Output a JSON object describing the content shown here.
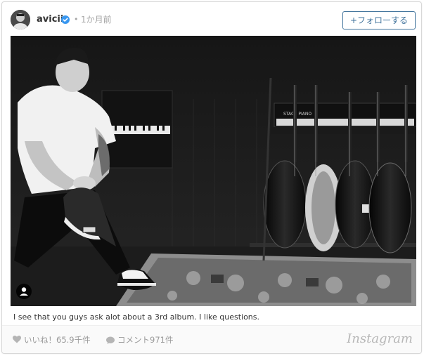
{
  "post": {
    "username": "avicii",
    "dot": "•",
    "time_ago": "1か月前",
    "follow_label": "+フォローする",
    "caption": "I see that you guys ask alot about a 3rd album. I like questions.",
    "likes": "いいね！65.9千件",
    "comments": "コメント971件",
    "brand": "Instagram"
  },
  "photo": {
    "piano_label": "STAGE PIANO",
    "subject": "man seated by piano with guitars",
    "style": "black-and-white"
  },
  "icons": {
    "verified": "verified-badge-icon",
    "heart": "heart-icon",
    "comment": "comment-bubble-icon",
    "user_tag": "user-tag-icon"
  },
  "colors": {
    "accent": "#3f729b",
    "verified": "#3897f0",
    "muted": "#999999"
  }
}
